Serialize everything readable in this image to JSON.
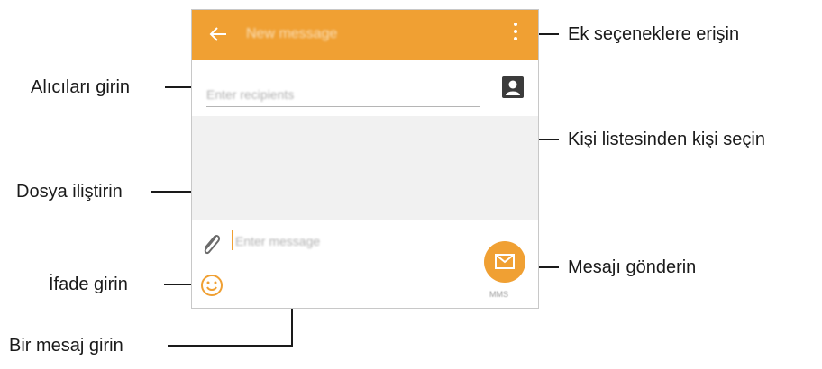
{
  "app": {
    "title": "New message",
    "recipients_placeholder": "Enter recipients",
    "message_placeholder": "Enter message",
    "send_label": "MMS",
    "accent_color": "#f0a033"
  },
  "callouts": {
    "more_options": "Ek seçeneklere erişin",
    "enter_recipients": "Alıcıları girin",
    "select_contact": "Kişi listesinden kişi seçin",
    "attach_file": "Dosya iliştirin",
    "enter_emoticon": "İfade girin",
    "send_message": "Mesajı gönderin",
    "enter_message": "Bir mesaj girin"
  },
  "icons": [
    "back-arrow-icon",
    "more-options-icon",
    "contact-icon",
    "paperclip-icon",
    "smiley-icon",
    "send-envelope-icon"
  ]
}
